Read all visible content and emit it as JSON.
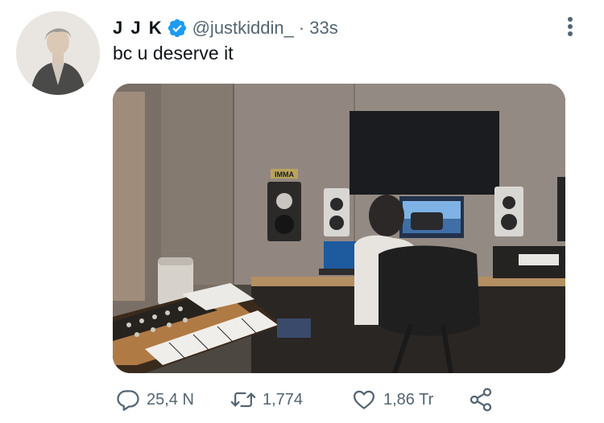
{
  "tweet": {
    "display_name": "J J K",
    "handle": "@justkiddin_",
    "separator": "·",
    "time": "33s",
    "text": "bc u deserve it",
    "verified": true
  },
  "media": {
    "label": "IMMA"
  },
  "actions": {
    "reply_count": "25,4 N",
    "retweet_count": "1,774",
    "like_count": "1,86 Tr"
  },
  "colors": {
    "verified_blue": "#1d9bf0",
    "secondary_text": "#536471",
    "primary_text": "#0f1419"
  },
  "icons": [
    "verified-badge-icon",
    "more-icon",
    "reply-icon",
    "retweet-icon",
    "like-icon",
    "share-icon"
  ]
}
